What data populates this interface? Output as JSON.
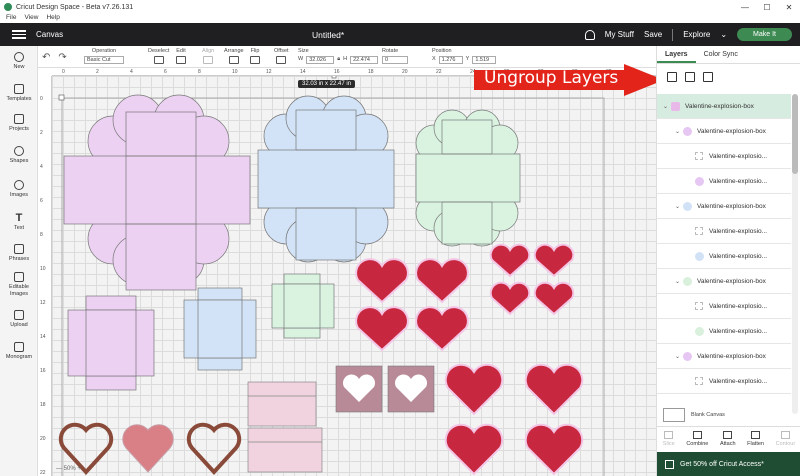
{
  "window": {
    "title": "Cricut Design Space - Beta v7.26.131",
    "menu": [
      "File",
      "View",
      "Help"
    ],
    "controls": [
      "—",
      "☐",
      "✕"
    ]
  },
  "header": {
    "canvas_label": "Canvas",
    "doc_title": "Untitled*",
    "my_stuff": "My Stuff",
    "save": "Save",
    "explore": "Explore",
    "make_it": "Make It"
  },
  "toolbar": {
    "operation_label": "Operation",
    "operation_value": "Basic Cut",
    "deselect": "Deselect",
    "edit": "Edit",
    "align": "Align",
    "arrange": "Arrange",
    "flip": "Flip",
    "offset": "Offset",
    "size_label": "Size",
    "w_label": "W",
    "w_value": "32.026",
    "h_label": "H",
    "h_value": "22.474",
    "rotate_label": "Rotate",
    "rotate_value": "0",
    "position_label": "Position",
    "x_label": "X",
    "x_value": "1.276",
    "y_label": "Y",
    "y_value": "1.519"
  },
  "leftbar": [
    {
      "label": "New",
      "icon": "plus-icon"
    },
    {
      "label": "Templates",
      "icon": "shirt-icon"
    },
    {
      "label": "Projects",
      "icon": "projects-icon"
    },
    {
      "label": "Shapes",
      "icon": "shapes-icon"
    },
    {
      "label": "Images",
      "icon": "lightbulb-icon"
    },
    {
      "label": "Text",
      "icon": "text-icon"
    },
    {
      "label": "Phrases",
      "icon": "phrases-icon"
    },
    {
      "label": "Editable Images",
      "icon": "editable-images-icon"
    },
    {
      "label": "Upload",
      "icon": "upload-icon"
    },
    {
      "label": "Monogram",
      "icon": "monogram-icon"
    }
  ],
  "ruler": {
    "top": [
      "0",
      "2",
      "4",
      "6",
      "8",
      "10",
      "12",
      "14",
      "16",
      "18",
      "20",
      "22",
      "24",
      "26",
      "28",
      "30",
      "32"
    ],
    "left": [
      "0",
      "2",
      "4",
      "6",
      "8",
      "10",
      "12",
      "14",
      "16",
      "18",
      "20",
      "22"
    ]
  },
  "canvas": {
    "size_tooltip": "32.03  in x 22.47  in",
    "zoom_hint": "— 50% +"
  },
  "annotation": {
    "text": "Ungroup Layers",
    "color": "#e3241b"
  },
  "panel": {
    "tabs": [
      "Layers",
      "Color Sync"
    ],
    "layers": [
      {
        "name": "Valentine-explosion-box",
        "level": 0,
        "selected": true,
        "color": "#e8b8e8",
        "kind": "group"
      },
      {
        "name": "Valentine-explosion-box",
        "level": 1,
        "color": "#e6c6f2",
        "kind": "group"
      },
      {
        "name": "Valentine-explosio...",
        "level": 2,
        "kind": "blank"
      },
      {
        "name": "Valentine-explosio...",
        "level": 2,
        "color": "#e6c6f2",
        "kind": "shape"
      },
      {
        "name": "Valentine-explosion-box",
        "level": 1,
        "color": "#d2e2f6",
        "kind": "group"
      },
      {
        "name": "Valentine-explosio...",
        "level": 2,
        "kind": "blank"
      },
      {
        "name": "Valentine-explosio...",
        "level": 2,
        "color": "#d2e2f6",
        "kind": "shape"
      },
      {
        "name": "Valentine-explosion-box",
        "level": 1,
        "color": "#d8f0dc",
        "kind": "group"
      },
      {
        "name": "Valentine-explosio...",
        "level": 2,
        "kind": "blank"
      },
      {
        "name": "Valentine-explosio...",
        "level": 2,
        "color": "#d8f0dc",
        "kind": "shape"
      },
      {
        "name": "Valentine-explosion-box",
        "level": 1,
        "color": "#e6c6f2",
        "kind": "group"
      },
      {
        "name": "Valentine-explosio...",
        "level": 2,
        "kind": "blank"
      }
    ],
    "blank_canvas": "Blank Canvas",
    "bottom_tools": [
      {
        "label": "Slice",
        "enabled": false
      },
      {
        "label": "Combine",
        "enabled": true
      },
      {
        "label": "Attach",
        "enabled": true
      },
      {
        "label": "Flatten",
        "enabled": true
      },
      {
        "label": "Contour",
        "enabled": false
      }
    ],
    "promo": "Get 50% off Cricut Access*"
  },
  "colors": {
    "header_bg": "#1f1f22",
    "accent": "#3e8a53",
    "pink": "#ecd1f2",
    "blue": "#d3e3f7",
    "green": "#d9f3e0",
    "heart_red": "#c8283f",
    "heart_dark": "#8c1b2c"
  }
}
